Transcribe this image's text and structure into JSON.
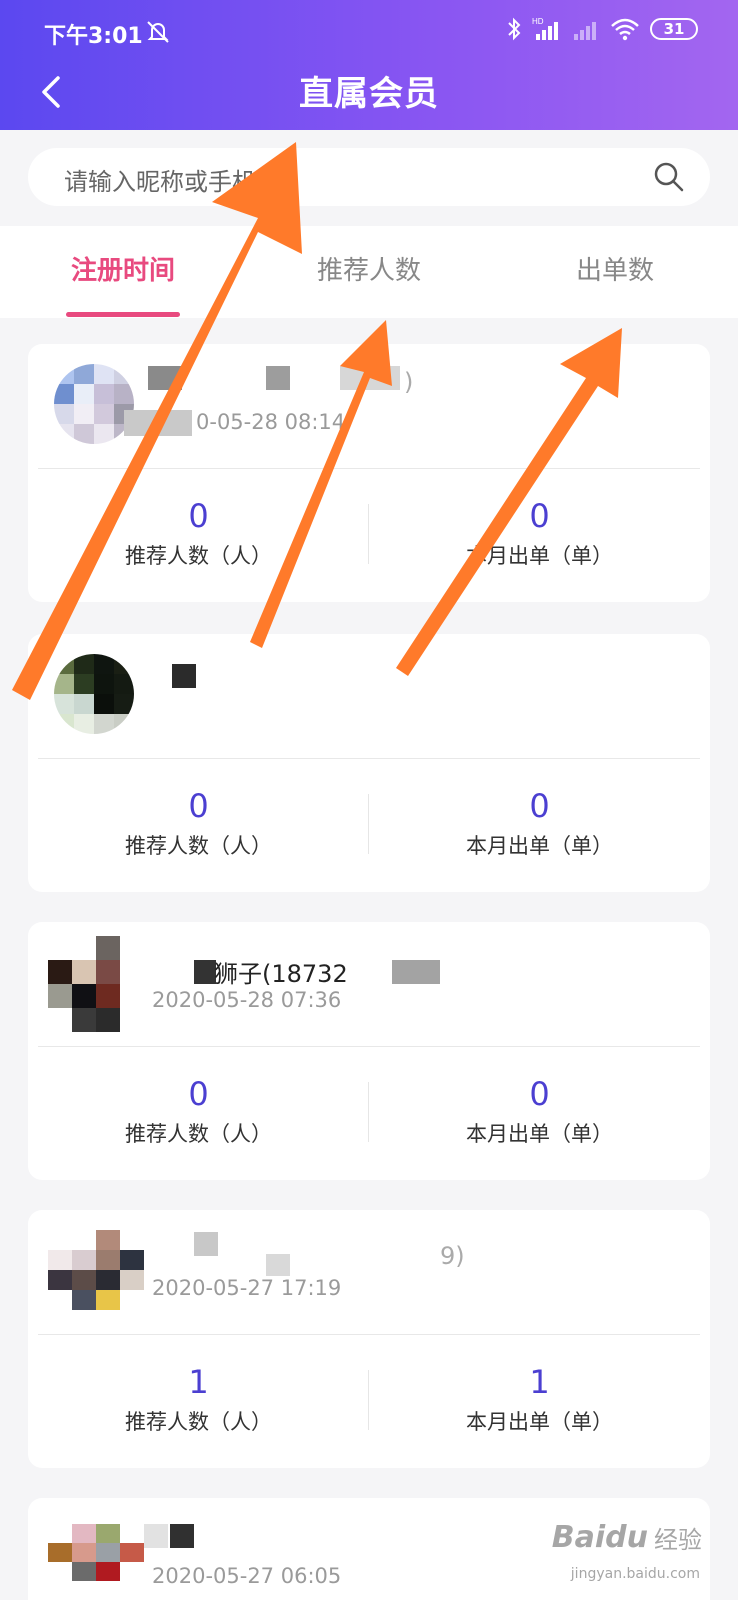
{
  "status_bar": {
    "time": "下午3:01",
    "battery": "31",
    "icons": [
      "bell-off-icon",
      "bluetooth-icon",
      "signal-hd-icon",
      "signal-icon",
      "wifi-icon",
      "battery-icon"
    ]
  },
  "header": {
    "title": "直属会员",
    "back_icon": "chevron-left-icon",
    "gradient": [
      "#5b48f0",
      "#a366f0"
    ]
  },
  "search": {
    "placeholder": "请输入昵称或手机号",
    "icon": "search-icon"
  },
  "tabs": [
    {
      "label": "注册时间",
      "active": true
    },
    {
      "label": "推荐人数",
      "active": false
    },
    {
      "label": "出单数",
      "active": false
    }
  ],
  "members": [
    {
      "name_suffix": ")",
      "date": "0-05-28 08:14",
      "referrals": "0",
      "referrals_label": "推荐人数（人）",
      "orders": "0",
      "orders_label": "本月出单（单）"
    },
    {
      "name_suffix": "",
      "date": "",
      "referrals": "0",
      "referrals_label": "推荐人数（人）",
      "orders": "0",
      "orders_label": "本月出单（单）"
    },
    {
      "name_suffix": "狮子(18732",
      "date": "2020-05-28 07:36",
      "referrals": "0",
      "referrals_label": "推荐人数（人）",
      "orders": "0",
      "orders_label": "本月出单（单）"
    },
    {
      "name_suffix": "9)",
      "date": "2020-05-27 17:19",
      "referrals": "1",
      "referrals_label": "推荐人数（人）",
      "orders": "1",
      "orders_label": "本月出单（单）"
    },
    {
      "name_suffix": "",
      "date": "2020-05-27 06:05"
    }
  ],
  "colors": {
    "accent": "#e84a7f",
    "value": "#4b3fd1",
    "arrow": "#ff7a2a"
  },
  "watermark": {
    "brand": "Baidu",
    "cn": "经验",
    "url": "jingyan.baidu.com"
  }
}
